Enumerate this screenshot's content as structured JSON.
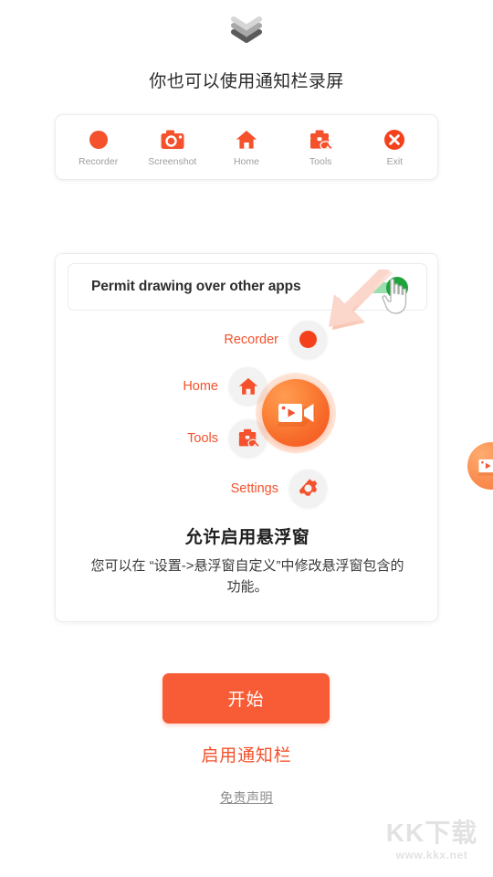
{
  "top": {
    "chevron_icon": "double-chevron-down-icon",
    "subtitle": "你也可以使用通知栏录屏"
  },
  "toolbar": {
    "items": [
      {
        "label": "Recorder",
        "icon": "record-dot-icon"
      },
      {
        "label": "Screenshot",
        "icon": "camera-icon"
      },
      {
        "label": "Home",
        "icon": "home-icon"
      },
      {
        "label": "Tools",
        "icon": "toolbox-wrench-icon"
      },
      {
        "label": "Exit",
        "icon": "close-circle-icon"
      }
    ]
  },
  "permission": {
    "label": "Permit drawing over other apps",
    "toggle_state": "on",
    "toggle_color": "#21a33c",
    "toggle_track_color": "#9adfb0",
    "pointer_icon": "hand-pointer-icon",
    "arrow_icon": "arrow-down-left-icon",
    "arrow_color": "#fbd6cb"
  },
  "floating_menu": {
    "items": [
      {
        "label": "Recorder",
        "icon": "record-dot-icon"
      },
      {
        "label": "Home",
        "icon": "home-icon"
      },
      {
        "label": "Tools",
        "icon": "toolbox-wrench-icon"
      },
      {
        "label": "Settings",
        "icon": "gear-icon"
      }
    ],
    "main_button_icon": "video-camera-icon",
    "accent_color": "#f4512c"
  },
  "card": {
    "title": "允许启用悬浮窗",
    "description": "您可以在 “设置->悬浮窗自定义”中修改悬浮窗包含的功能。"
  },
  "edge_widget": {
    "icon": "video-camera-icon"
  },
  "actions": {
    "start_label": "开始",
    "start_color": "#f75c36",
    "notification_link": "启用通知栏",
    "disclaimer_link": "免责声明"
  },
  "watermark": {
    "main": "KK下载",
    "sub": "www.kkx.net"
  }
}
